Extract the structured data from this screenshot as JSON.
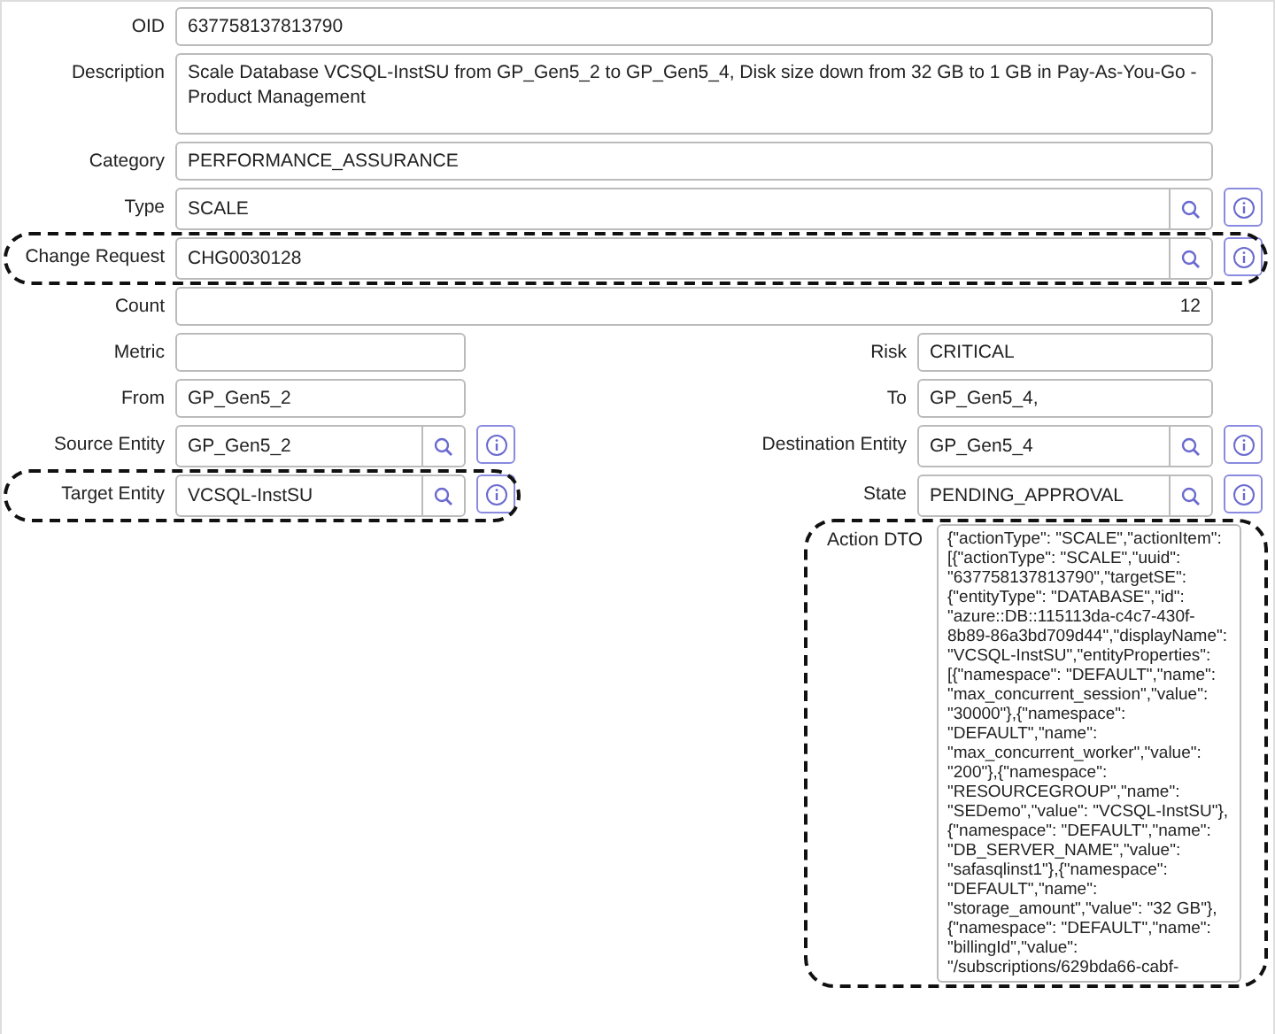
{
  "rows": [
    {
      "kind": "full",
      "field": {
        "label": "OID",
        "value": "637758137813790",
        "kind": "text",
        "info": false,
        "highlighted": false
      }
    },
    {
      "kind": "full",
      "field": {
        "label": "Description",
        "value": "Scale Database VCSQL-InstSU from GP_Gen5_2 to GP_Gen5_4, Disk size down from 32 GB to 1 GB in Pay-As-You-Go - Product Management",
        "kind": "textarea",
        "info": false,
        "highlighted": false
      }
    },
    {
      "kind": "full",
      "field": {
        "label": "Category",
        "value": "PERFORMANCE_ASSURANCE",
        "kind": "text",
        "info": false,
        "highlighted": false
      }
    },
    {
      "kind": "full",
      "field": {
        "label": "Type",
        "value": "SCALE",
        "kind": "lookup",
        "info": true,
        "highlighted": false
      }
    },
    {
      "kind": "full",
      "field": {
        "label": "Change Request",
        "value": "CHG0030128",
        "kind": "lookup",
        "info": true,
        "highlighted": true
      }
    },
    {
      "kind": "full",
      "field": {
        "label": "Count",
        "value": "12",
        "kind": "number",
        "info": false,
        "highlighted": false
      }
    },
    {
      "kind": "pair",
      "left": {
        "label": "Metric",
        "kind": "text",
        "info": false,
        "highlighted": false
      },
      "right": {
        "label": "Risk",
        "value": "CRITICAL",
        "kind": "text",
        "info": false,
        "highlighted": false
      }
    },
    {
      "kind": "pair",
      "left": {
        "label": "From",
        "value": "GP_Gen5_2",
        "kind": "text",
        "info": false,
        "highlighted": false
      },
      "right": {
        "label": "To",
        "value": "GP_Gen5_4,",
        "kind": "text",
        "info": false,
        "highlighted": false
      }
    },
    {
      "kind": "pair",
      "left": {
        "label": "Source Entity",
        "value": "GP_Gen5_2",
        "kind": "lookup",
        "info": true,
        "highlighted": false
      },
      "right": {
        "label": "Destination Entity",
        "value": "GP_Gen5_4",
        "kind": "lookup",
        "info": true,
        "highlighted": false
      }
    },
    {
      "kind": "pair",
      "left": {
        "label": "Target Entity",
        "value": "VCSQL-InstSU",
        "kind": "lookup",
        "info": true,
        "highlighted": true
      },
      "right": {
        "label": "State",
        "value": "PENDING_APPROVAL",
        "kind": "lookup",
        "info": true,
        "highlighted": false
      }
    },
    {
      "kind": "pair",
      "right": {
        "label": "Action DTO",
        "value": "{\"actionType\": \"SCALE\",\"actionItem\": [{\"actionType\": \"SCALE\",\"uuid\": \"637758137813790\",\"targetSE\": {\"entityType\": \"DATABASE\",\"id\": \"azure::DB::115113da-c4c7-430f-8b89-86a3bd709d44\",\"displayName\": \"VCSQL-InstSU\",\"entityProperties\": [{\"namespace\": \"DEFAULT\",\"name\": \"max_concurrent_session\",\"value\": \"30000\"},{\"namespace\": \"DEFAULT\",\"name\": \"max_concurrent_worker\",\"value\": \"200\"},{\"namespace\": \"RESOURCEGROUP\",\"name\": \"SEDemo\",\"value\": \"VCSQL-InstSU\"},{\"namespace\": \"DEFAULT\",\"name\": \"DB_SERVER_NAME\",\"value\": \"safasqlinst1\"},{\"namespace\": \"DEFAULT\",\"name\": \"storage_amount\",\"value\": \"32 GB\"},{\"namespace\": \"DEFAULT\",\"name\": \"billingId\",\"value\": \"/subscriptions/629bda66-cabf-",
        "kind": "json",
        "info": false,
        "highlighted": true
      }
    }
  ]
}
